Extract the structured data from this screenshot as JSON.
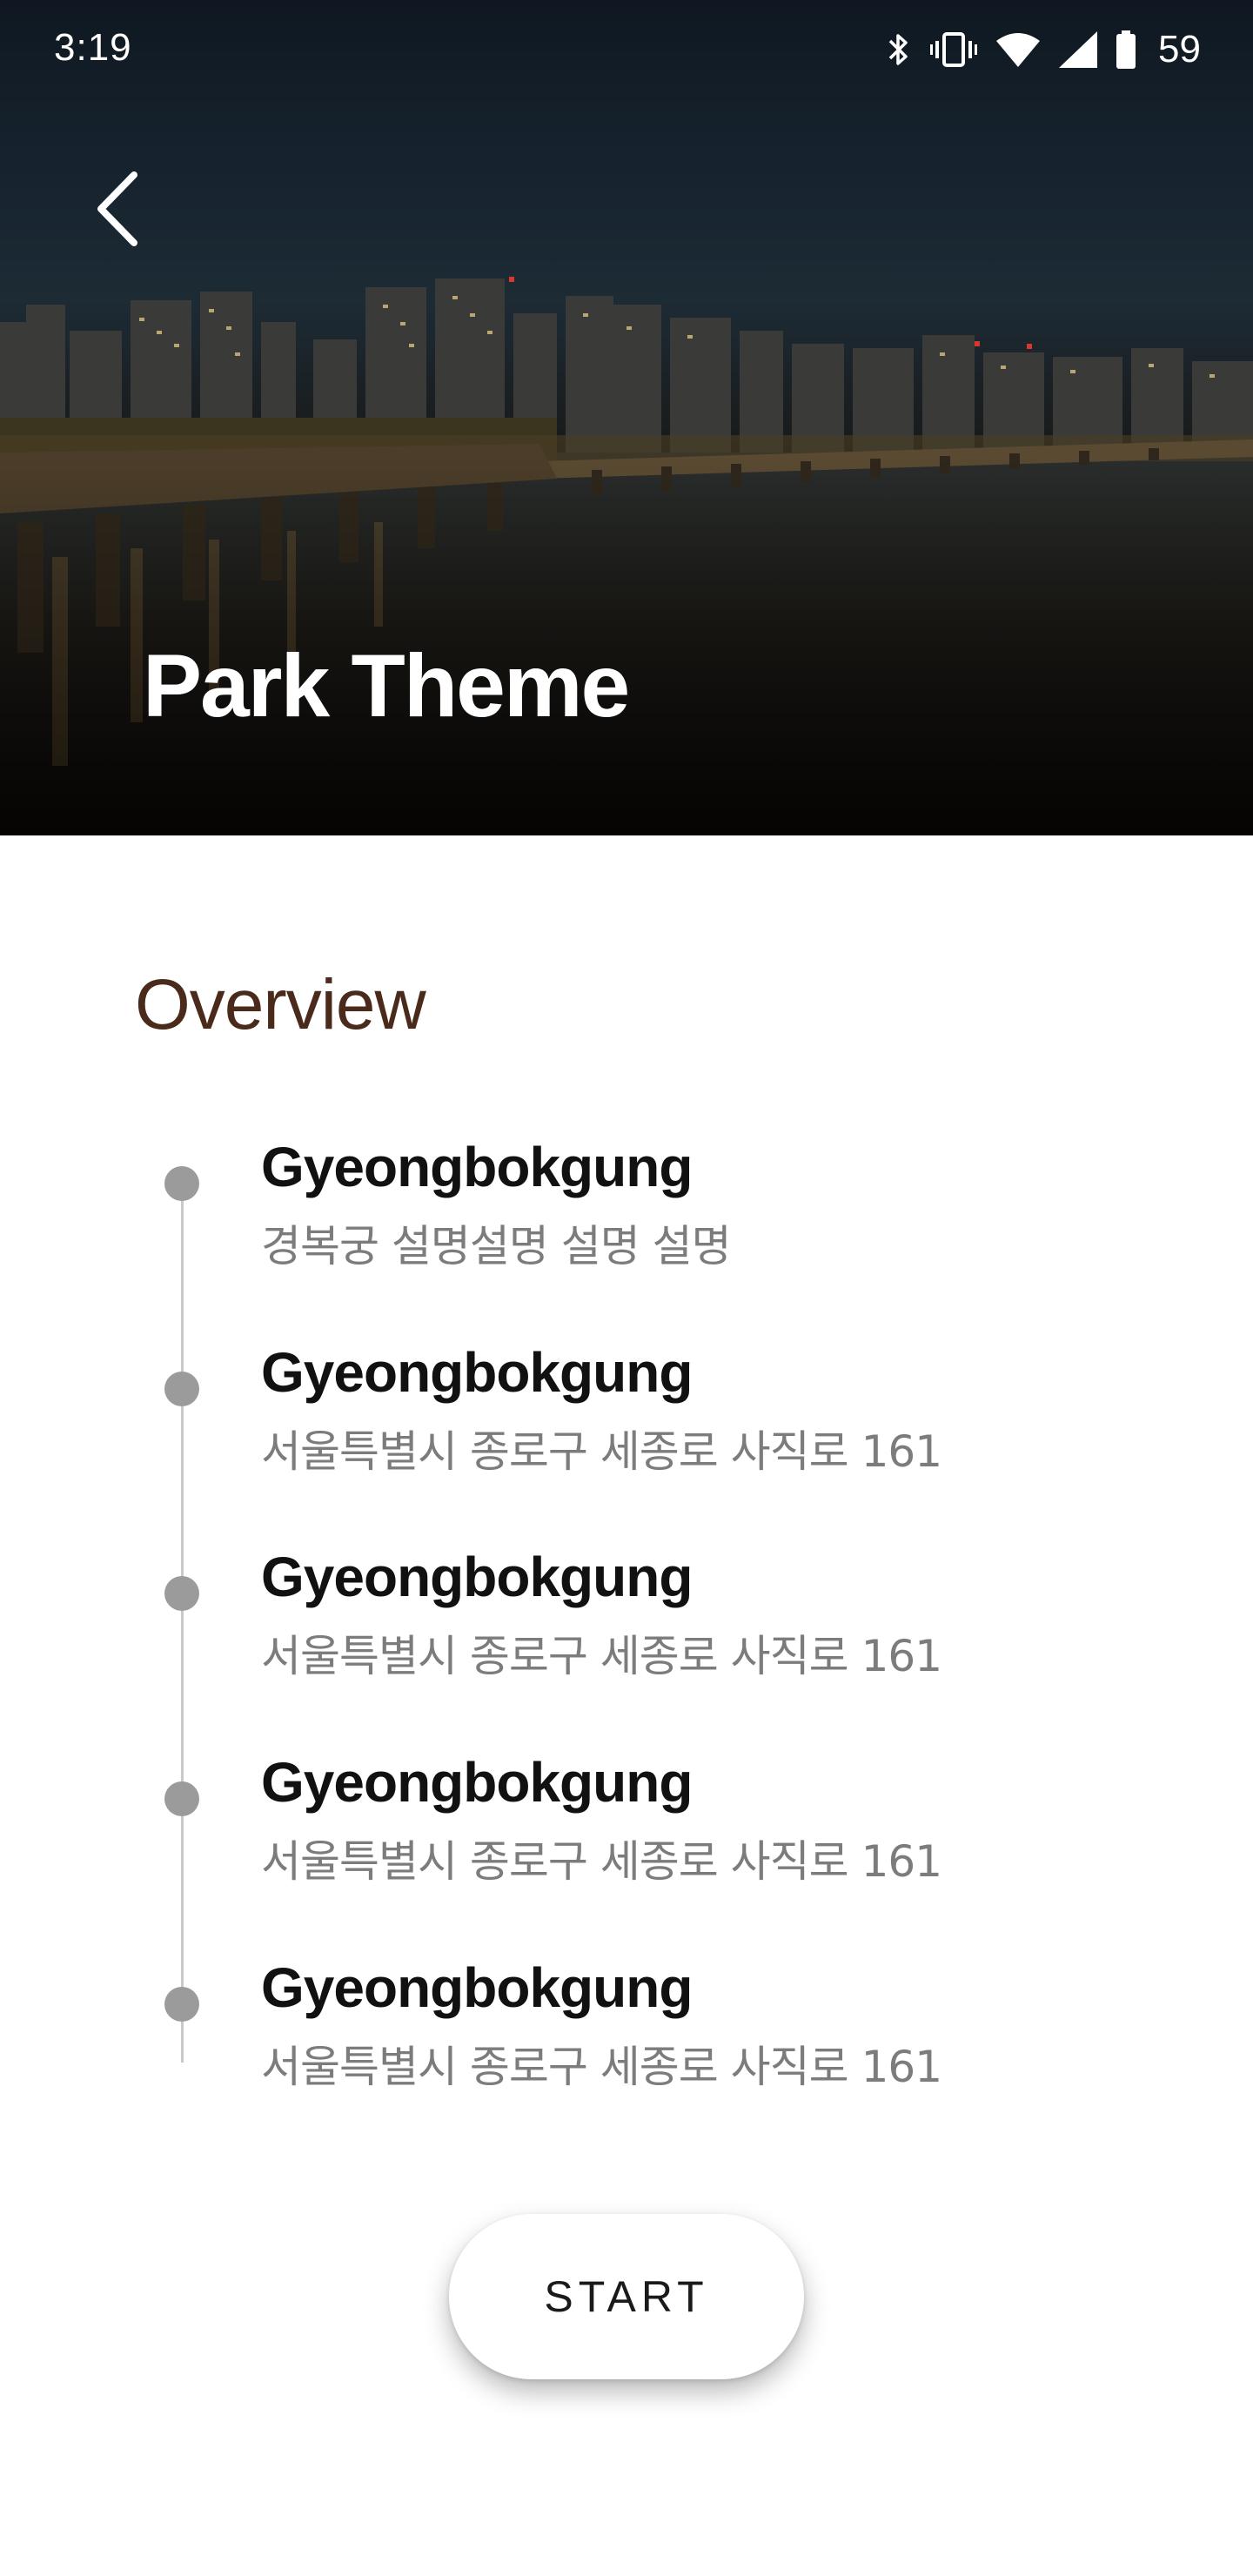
{
  "status_bar": {
    "time": "3:19",
    "battery_level": "59",
    "icons": [
      "bluetooth-icon",
      "vibrate-icon",
      "wifi-icon",
      "signal-icon",
      "battery-icon"
    ]
  },
  "header": {
    "back_icon": "back-arrow-icon",
    "title": "Park Theme"
  },
  "overview": {
    "heading": "Overview",
    "stops": [
      {
        "name": "Gyeongbokgung",
        "description": "경복궁 설명설명 설명 설명"
      },
      {
        "name": "Gyeongbokgung",
        "description": "서울특별시 종로구 세종로 사직로 161"
      },
      {
        "name": "Gyeongbokgung",
        "description": "서울특별시 종로구 세종로 사직로 161"
      },
      {
        "name": "Gyeongbokgung",
        "description": "서울특별시 종로구 세종로 사직로 161"
      },
      {
        "name": "Gyeongbokgung",
        "description": "서울특별시 종로구 세종로 사직로 161"
      }
    ]
  },
  "actions": {
    "start_label": "START"
  },
  "colors": {
    "heading": "#4a2a1b",
    "dot": "#9b9b9b",
    "line": "#c9c9c9",
    "description": "#7c7c7c"
  }
}
